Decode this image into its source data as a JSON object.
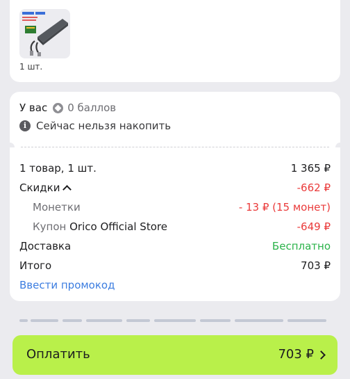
{
  "product": {
    "quantity": "1 шт.",
    "thumb_icon": "ssd-enclosure-product-image"
  },
  "bonus": {
    "prefix": "У вас",
    "points": "0 баллов",
    "coin_icon": "bonus-coin-icon",
    "info_icon": "info-icon",
    "info_text": "Сейчас нельзя накопить"
  },
  "summary": {
    "items_label": "1 товар, 1 шт.",
    "items_value": "1 365 ₽",
    "discounts_label": "Скидки",
    "discounts_value": "-662 ₽",
    "coins_label": "Монетки",
    "coins_value": "- 13 ₽ (15 монет)",
    "coupon_prefix": "Купон",
    "coupon_store": "Orico Official Store",
    "coupon_value": "-649 ₽",
    "delivery_label": "Доставка",
    "delivery_value": "Бесплатно",
    "total_label": "Итого",
    "total_value": "703 ₽",
    "promo_link": "Ввести промокод"
  },
  "footer": {
    "pay_label": "Оплатить",
    "pay_amount": "703 ₽"
  },
  "colors": {
    "accent_green_button": "#b9f04a",
    "discount_red": "#ea3a3a",
    "free_green": "#2bb34a",
    "link_blue": "#3c7de0",
    "background": "#ebebef"
  }
}
